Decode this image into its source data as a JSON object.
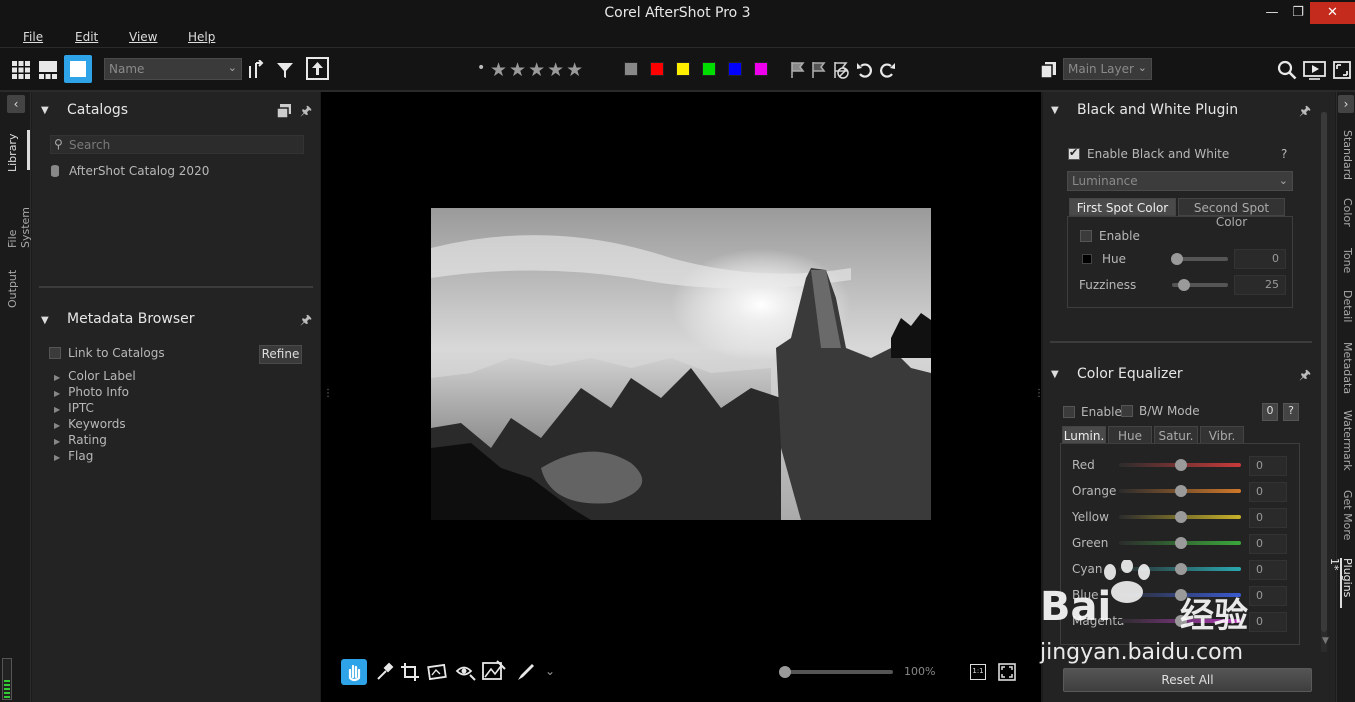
{
  "app": {
    "title": "Corel AfterShot Pro 3"
  },
  "window": {
    "minimize": "—",
    "restore": "❐",
    "close": "✕"
  },
  "menu": {
    "file": "File",
    "edit": "Edit",
    "view": "View",
    "help": "Help"
  },
  "toolbar": {
    "sort_value": "Name",
    "layer_value": "Main Layer",
    "rating_dot": "•",
    "stars": "★★★★★",
    "colors": [
      "#888888",
      "#ff0000",
      "#ffee00",
      "#00dd00",
      "#0000ff",
      "#ee00ee"
    ]
  },
  "left_tabs": {
    "library": "Library",
    "file_system": "File System",
    "output": "Output"
  },
  "catalogs": {
    "title": "Catalogs",
    "search_placeholder": "Search",
    "items": [
      "AfterShot Catalog 2020"
    ]
  },
  "metadata": {
    "title": "Metadata Browser",
    "link": "Link to Catalogs",
    "refine": "Refine",
    "items": [
      "Color Label",
      "Photo Info",
      "IPTC",
      "Keywords",
      "Rating",
      "Flag"
    ]
  },
  "viewer": {
    "zoom": "100%",
    "zoom_fraction": 0.05,
    "btn_1to1": "1:1"
  },
  "bw": {
    "title": "Black and White Plugin",
    "enable": "Enable Black and White",
    "help": "?",
    "mode": "Luminance",
    "tab1": "First Spot Color",
    "tab2": "Second Spot Color",
    "spot_enable": "Enable",
    "hue_label": "Hue",
    "hue_value": "0",
    "fuzz_label": "Fuzziness",
    "fuzz_value": "25"
  },
  "ce": {
    "title": "Color Equalizer",
    "enable": "Enable",
    "bw_mode": "B/W Mode",
    "zero": "0",
    "help": "?",
    "tabs": [
      "Lumin.",
      "Hue",
      "Satur.",
      "Vibr."
    ],
    "rows": [
      {
        "label": "Red",
        "value": "0",
        "color": "#c83a3a"
      },
      {
        "label": "Orange",
        "value": "0",
        "color": "#d0782a"
      },
      {
        "label": "Yellow",
        "value": "0",
        "color": "#c8b22a"
      },
      {
        "label": "Green",
        "value": "0",
        "color": "#3aa83a"
      },
      {
        "label": "Cyan",
        "value": "0",
        "color": "#2aa8b0"
      },
      {
        "label": "Blue",
        "value": "0",
        "color": "#3a5ad0"
      },
      {
        "label": "Magenta",
        "value": "0",
        "color": "#b03ab8"
      }
    ]
  },
  "reset": "Reset All",
  "right_tabs": [
    "Standard",
    "Color",
    "Tone",
    "Detail",
    "Metadata",
    "Watermark",
    "Get More",
    "Plugins 1*"
  ],
  "watermark": {
    "brand": "Bai",
    "brand2": "经验",
    "url": "jingyan.baidu.com"
  }
}
